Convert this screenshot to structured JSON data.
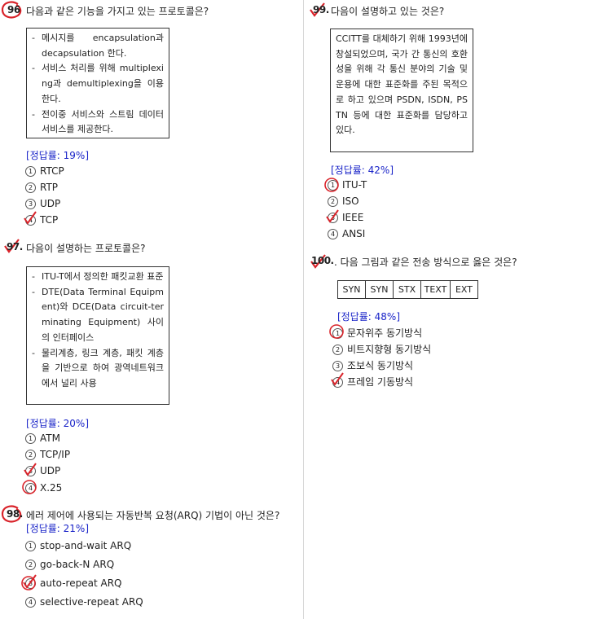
{
  "q96": {
    "number": "96",
    "question": "다음과 같은 기능을 가지고 있는 프로토콜은?",
    "box_items": [
      "메시지를 encapsulation과 decapsulation 한다.",
      "서비스 처리를 위해 multiplexing과 demultiplexing을 이용한다.",
      "전이중 서비스와 스트림 데이터 서비스를 제공한다."
    ],
    "rate": "[정답률: 19%]",
    "options": [
      {
        "n": "①",
        "text": "RTCP"
      },
      {
        "n": "②",
        "text": "RTP"
      },
      {
        "n": "③",
        "text": "UDP"
      },
      {
        "n": "④",
        "text": "TCP"
      }
    ]
  },
  "q97": {
    "number": "97.",
    "question": "다음이 설명하는 프로토콜은?",
    "box_items": [
      "ITU-T에서 정의한 패킷교환 표준",
      "DTE(Data Terminal Equipment)와 DCE(Data circuit-terminating Equipment) 사이의 인터페이스",
      "물리계층, 링크 계층, 패킷 계층을 기반으로 하여 광역네트워크에서 널리 사용"
    ],
    "rate": "[정답률: 20%]",
    "options": [
      {
        "n": "①",
        "text": "ATM"
      },
      {
        "n": "②",
        "text": "TCP/IP"
      },
      {
        "n": "③",
        "text": "UDP"
      },
      {
        "n": "④",
        "text": "X.25"
      }
    ]
  },
  "q98": {
    "number": "98.",
    "question": "에러 제어에 사용되는 자동반복 요청(ARQ) 기법이 아닌 것은?",
    "rate": "[정답률: 21%]",
    "options": [
      {
        "n": "①",
        "text": "stop-and-wait ARQ"
      },
      {
        "n": "②",
        "text": "go-back-N ARQ"
      },
      {
        "n": "③",
        "text": "auto-repeat ARQ"
      },
      {
        "n": "④",
        "text": "selective-repeat ARQ"
      }
    ]
  },
  "q99": {
    "number": "99.",
    "question": "다음이 설명하고 있는 것은?",
    "box_text": "CCITT를 대체하기 위해 1993년에 창설되었으며, 국가 간 통신의 호환성을 위해 각 통신 분야의 기술 및 운용에 대한 표준화를 주된 목적으로 하고 있으며 PSDN, ISDN, PSTN 등에 대한 표준화를 담당하고 있다.",
    "rate": "[정답률: 42%]",
    "options": [
      {
        "n": "①",
        "text": "ITU-T"
      },
      {
        "n": "②",
        "text": "ISO"
      },
      {
        "n": "③",
        "text": "IEEE"
      },
      {
        "n": "④",
        "text": "ANSI"
      }
    ]
  },
  "q100": {
    "number": "100.",
    "question": ". 다음 그림과 같은 전송 방식으로 옳은 것은?",
    "frame_cells": [
      "SYN",
      "SYN",
      "STX",
      "TEXT",
      "EXT"
    ],
    "rate": "[정답률: 48%]",
    "options": [
      {
        "n": "①",
        "text": "문자위주 동기방식"
      },
      {
        "n": "②",
        "text": "비트지향형 동기방식"
      },
      {
        "n": "③",
        "text": "조보식 동기방식"
      },
      {
        "n": "④",
        "text": "프레임 기동방식"
      }
    ]
  },
  "colors": {
    "rate": "#1a24c8",
    "mark": "#d9232a"
  }
}
